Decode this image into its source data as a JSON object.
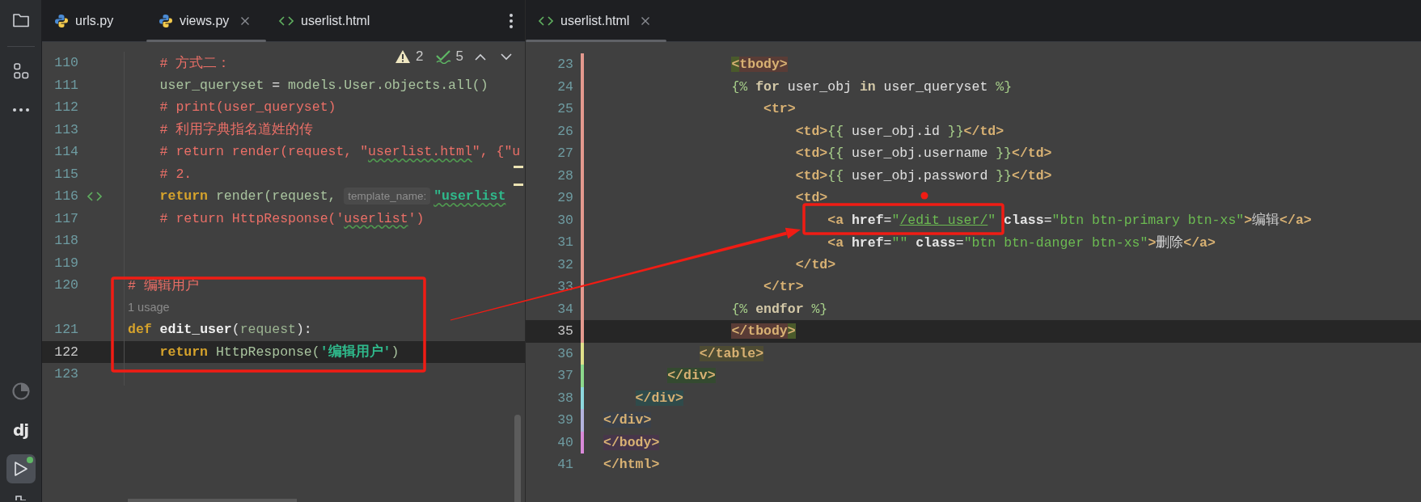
{
  "sidebar": {
    "top": [
      {
        "kind": "folder",
        "selected": false
      },
      {
        "kind": "structure",
        "selected": false
      },
      {
        "kind": "more",
        "selected": false
      }
    ],
    "bottom": [
      {
        "kind": "profiler",
        "selected": false,
        "running": false
      },
      {
        "kind": "django",
        "label": "dj",
        "selected": false,
        "running": false
      },
      {
        "kind": "run",
        "selected": true,
        "running": true
      },
      {
        "kind": "python",
        "selected": false,
        "running": false
      }
    ]
  },
  "left_pane": {
    "tabs": [
      {
        "label": "urls.py",
        "kind": "python",
        "selected": false,
        "closable": false
      },
      {
        "label": "views.py",
        "kind": "python",
        "selected": true,
        "closable": true
      },
      {
        "label": "userlist.html",
        "kind": "html",
        "selected": false,
        "closable": false
      }
    ],
    "inspections": {
      "warnings": "2",
      "weak_warnings": "5"
    },
    "lines": [
      {
        "kind": "code",
        "num": "110",
        "current": false,
        "tokens": [
          {
            "t": "    # 方式二：",
            "kind": "cmt"
          }
        ]
      },
      {
        "kind": "code",
        "num": "111",
        "current": false,
        "tokens": [
          {
            "t": "    user_queryset",
            "kind": "id"
          },
          {
            "t": " = ",
            "kind": "op"
          },
          {
            "t": "models.User.objects.all()",
            "kind": "id"
          }
        ]
      },
      {
        "kind": "code",
        "num": "112",
        "current": false,
        "tokens": [
          {
            "t": "    # print(user_queryset)",
            "kind": "cmt"
          }
        ]
      },
      {
        "kind": "code",
        "num": "113",
        "current": false,
        "tokens": [
          {
            "t": "    # 利用字典指名道姓的传",
            "kind": "cmt"
          }
        ]
      },
      {
        "kind": "code",
        "num": "114",
        "current": false,
        "tokens": [
          {
            "t": "    # return render(request, \"",
            "kind": "cmt"
          },
          {
            "t": "userlist.html",
            "kind": "cmt",
            "squiggly": true
          },
          {
            "t": "\", {\"u",
            "kind": "cmt"
          }
        ]
      },
      {
        "kind": "code",
        "num": "115",
        "current": false,
        "tokens": [
          {
            "t": "    # 2.",
            "kind": "cmt"
          }
        ]
      },
      {
        "kind": "code",
        "num": "116",
        "current": false,
        "template_link": true,
        "tokens": [
          {
            "t": "    return",
            "kind": "kw"
          },
          {
            "t": " render(request, ",
            "kind": "id"
          },
          {
            "t": "template_name:",
            "kind": "hint"
          },
          {
            "t": "\"userlist",
            "kind": "str",
            "squiggly": true
          }
        ]
      },
      {
        "kind": "code",
        "num": "117",
        "current": false,
        "tokens": [
          {
            "t": "    # return HttpResponse('",
            "kind": "cmt"
          },
          {
            "t": "userlist",
            "kind": "cmt",
            "squiggly": true
          },
          {
            "t": "')",
            "kind": "cmt"
          }
        ]
      },
      {
        "kind": "code",
        "num": "118",
        "current": false
      },
      {
        "kind": "code",
        "num": "119",
        "current": false
      },
      {
        "kind": "code",
        "num": "120",
        "current": false,
        "tokens": [
          {
            "t": "# 编辑用户",
            "kind": "cmt"
          }
        ]
      },
      {
        "kind": "usage",
        "text": "1 usage",
        "current": false
      },
      {
        "kind": "code",
        "num": "121",
        "current": false,
        "tokens": [
          {
            "t": "def",
            "kind": "kw"
          },
          {
            "t": " edit_user",
            "kind": "fn"
          },
          {
            "t": "(",
            "kind": "op"
          },
          {
            "t": "request",
            "kind": "param"
          },
          {
            "t": "):",
            "kind": "op"
          }
        ]
      },
      {
        "kind": "code",
        "num": "122",
        "current": true,
        "tokens": [
          {
            "t": "    return",
            "kind": "kw"
          },
          {
            "t": " HttpResponse(",
            "kind": "id"
          },
          {
            "t": "'编辑用户'",
            "kind": "str"
          },
          {
            "t": ")",
            "kind": "id"
          }
        ]
      },
      {
        "kind": "code",
        "num": "123",
        "current": false
      }
    ]
  },
  "right_pane": {
    "tabs": [
      {
        "label": "userlist.html",
        "kind": "html",
        "selected": true,
        "closable": true
      }
    ],
    "lines": [
      {
        "num": "23",
        "current": false,
        "color": "#e3998e",
        "tokens": [
          {
            "t": "                <",
            "kind": "tag",
            "color": "#4a5a2b"
          },
          {
            "t": "tbody>",
            "kind": "tag",
            "color": "#5a3c36"
          }
        ]
      },
      {
        "num": "24",
        "current": false,
        "color": "#e3998e",
        "tokens": [
          {
            "t": "                {%",
            "kind": "tpl"
          },
          {
            "t": " for ",
            "kind": "tkw"
          },
          {
            "t": "user_obj",
            "kind": "tvar"
          },
          {
            "t": " in ",
            "kind": "tkw"
          },
          {
            "t": "user_queryset",
            "kind": "tvar"
          },
          {
            "t": " %}",
            "kind": "tpl"
          }
        ]
      },
      {
        "num": "25",
        "current": false,
        "color": "#e3998e",
        "tokens": [
          {
            "t": "                    <tr>",
            "kind": "tag"
          }
        ]
      },
      {
        "num": "26",
        "current": false,
        "color": "#e3998e",
        "tokens": [
          {
            "t": "                        <td>",
            "kind": "tag"
          },
          {
            "t": "{{",
            "kind": "tpl"
          },
          {
            "t": " user_obj.id ",
            "kind": "tvar"
          },
          {
            "t": "}}",
            "kind": "tpl"
          },
          {
            "t": "</td>",
            "kind": "tag"
          }
        ]
      },
      {
        "num": "27",
        "current": false,
        "color": "#e3998e",
        "tokens": [
          {
            "t": "                        <td>",
            "kind": "tag"
          },
          {
            "t": "{{",
            "kind": "tpl"
          },
          {
            "t": " user_obj.username ",
            "kind": "tvar"
          },
          {
            "t": "}}",
            "kind": "tpl"
          },
          {
            "t": "</td>",
            "kind": "tag"
          }
        ]
      },
      {
        "num": "28",
        "current": false,
        "color": "#e3998e",
        "tokens": [
          {
            "t": "                        <td>",
            "kind": "tag"
          },
          {
            "t": "{{",
            "kind": "tpl"
          },
          {
            "t": " user_obj.password ",
            "kind": "tvar"
          },
          {
            "t": "}}",
            "kind": "tpl"
          },
          {
            "t": "</td>",
            "kind": "tag"
          }
        ]
      },
      {
        "num": "29",
        "current": false,
        "color": "#e3998e",
        "tokens": [
          {
            "t": "                        <td>",
            "kind": "tag"
          }
        ]
      },
      {
        "num": "30",
        "current": false,
        "color": "#e3998e",
        "tokens": [
          {
            "t": "                            <a ",
            "kind": "tag"
          },
          {
            "t": "href",
            "kind": "attr"
          },
          {
            "t": "=",
            "kind": "op"
          },
          {
            "t": "\"",
            "kind": "astr"
          },
          {
            "t": "/edit_user/",
            "kind": "link"
          },
          {
            "t": "\"",
            "kind": "astr"
          },
          {
            "t": " class",
            "kind": "attr"
          },
          {
            "t": "=",
            "kind": "op"
          },
          {
            "t": "\"btn btn-primary btn-xs\"",
            "kind": "astr"
          },
          {
            "t": ">",
            "kind": "tag"
          },
          {
            "t": "编辑",
            "kind": "text"
          },
          {
            "t": "</a>",
            "kind": "tag"
          }
        ]
      },
      {
        "num": "31",
        "current": false,
        "color": "#e3998e",
        "tokens": [
          {
            "t": "                            <a ",
            "kind": "tag"
          },
          {
            "t": "href",
            "kind": "attr"
          },
          {
            "t": "=",
            "kind": "op"
          },
          {
            "t": "\"\"",
            "kind": "astr"
          },
          {
            "t": " class",
            "kind": "attr"
          },
          {
            "t": "=",
            "kind": "op"
          },
          {
            "t": "\"btn btn-danger btn-xs\"",
            "kind": "astr"
          },
          {
            "t": ">",
            "kind": "tag"
          },
          {
            "t": "删除",
            "kind": "text"
          },
          {
            "t": "</a>",
            "kind": "tag"
          }
        ]
      },
      {
        "num": "32",
        "current": false,
        "color": "#e3998e",
        "tokens": [
          {
            "t": "                        </td>",
            "kind": "tag"
          }
        ]
      },
      {
        "num": "33",
        "current": false,
        "color": "#e3998e",
        "tokens": [
          {
            "t": "                    </tr>",
            "kind": "tag"
          }
        ]
      },
      {
        "num": "34",
        "current": false,
        "color": "#e3998e",
        "tokens": [
          {
            "t": "                {%",
            "kind": "tpl"
          },
          {
            "t": " endfor ",
            "kind": "tkw"
          },
          {
            "t": "%}",
            "kind": "tpl"
          }
        ]
      },
      {
        "num": "35",
        "current": true,
        "color": "#e3998e",
        "tokens": [
          {
            "t": "                </tbody",
            "kind": "tag",
            "color": "#5a3c36"
          },
          {
            "t": ">",
            "kind": "tag",
            "color": "#4a5a2b"
          }
        ]
      },
      {
        "num": "36",
        "current": false,
        "color": "#e0e08a",
        "tokens": [
          {
            "t": "            </table>",
            "kind": "tag",
            "color": "#4d4b33"
          }
        ]
      },
      {
        "num": "37",
        "current": false,
        "color": "#8cd98c",
        "tokens": [
          {
            "t": "        </div>",
            "kind": "tag",
            "color": "#344a30"
          }
        ]
      },
      {
        "num": "38",
        "current": false,
        "color": "#8dd8df",
        "tokens": [
          {
            "t": "    </div>",
            "kind": "tag",
            "color": "#2f4b4b"
          }
        ]
      },
      {
        "num": "39",
        "current": false,
        "color": "#b3b3de",
        "tokens": [
          {
            "t": "</div>",
            "kind": "tag",
            "color": "#3a4049"
          }
        ]
      },
      {
        "num": "40",
        "current": false,
        "color": "#d98ad9",
        "tokens": [
          {
            "t": "</body>",
            "kind": "tag",
            "color": "#47364a"
          }
        ]
      },
      {
        "num": "41",
        "current": false,
        "tokens": [
          {
            "t": "</html>",
            "kind": "tag"
          }
        ]
      }
    ]
  },
  "annotations": [
    {
      "kind": "frame"
    },
    {
      "kind": "frame"
    },
    {
      "kind": "arrow"
    },
    {
      "kind": "dot"
    }
  ]
}
